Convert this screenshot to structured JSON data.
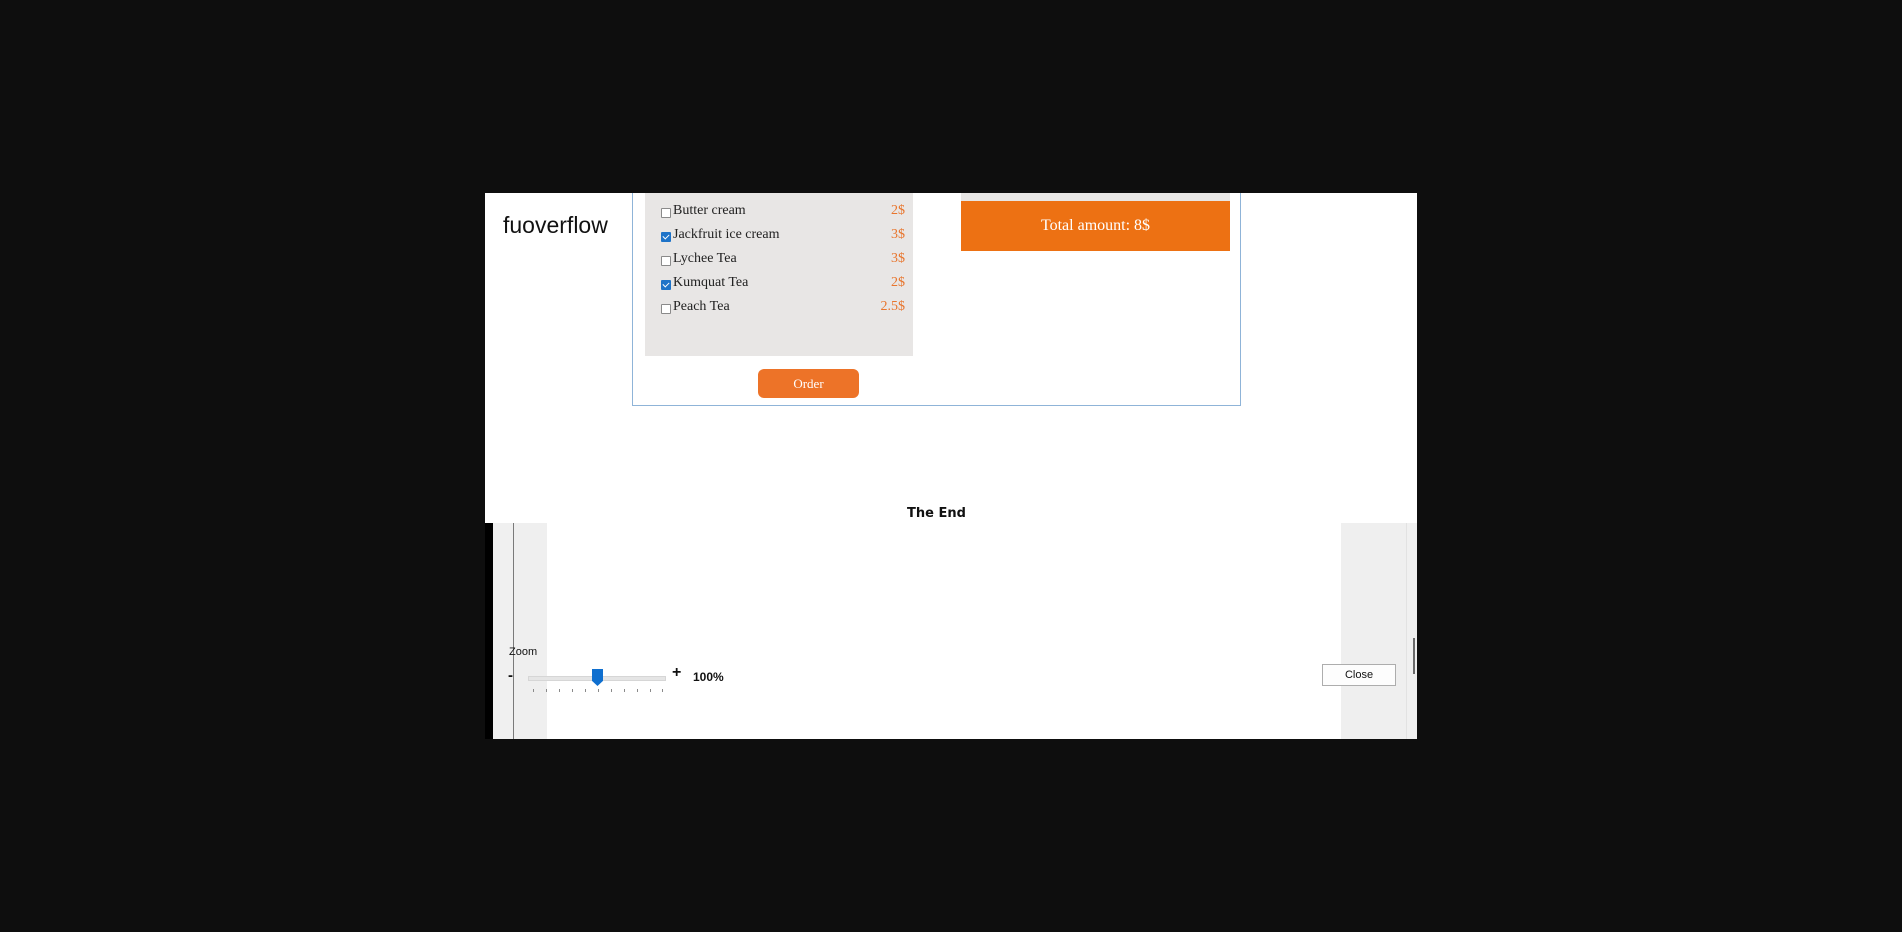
{
  "app": {
    "logo_text": "fuoverflow"
  },
  "menu": {
    "items": [
      {
        "name": "Butter cream",
        "price": "2$",
        "checked": false
      },
      {
        "name": "Jackfruit ice cream",
        "price": "3$",
        "checked": true
      },
      {
        "name": "Lychee Tea",
        "price": "3$",
        "checked": false
      },
      {
        "name": "Kumquat Tea",
        "price": "2$",
        "checked": true
      },
      {
        "name": "Peach Tea",
        "price": "2.5$",
        "checked": false
      }
    ],
    "order_label": "Order"
  },
  "total": {
    "label": "Total amount: 8$"
  },
  "footer_text": "The End",
  "zoom": {
    "label": "Zoom",
    "minus": "-",
    "plus": "+",
    "value": "100%",
    "level_percent": 100
  },
  "dialog": {
    "close_label": "Close"
  },
  "colors": {
    "accent": "#ed7113",
    "price": "#e8752d",
    "checkbox": "#1e73c8"
  }
}
